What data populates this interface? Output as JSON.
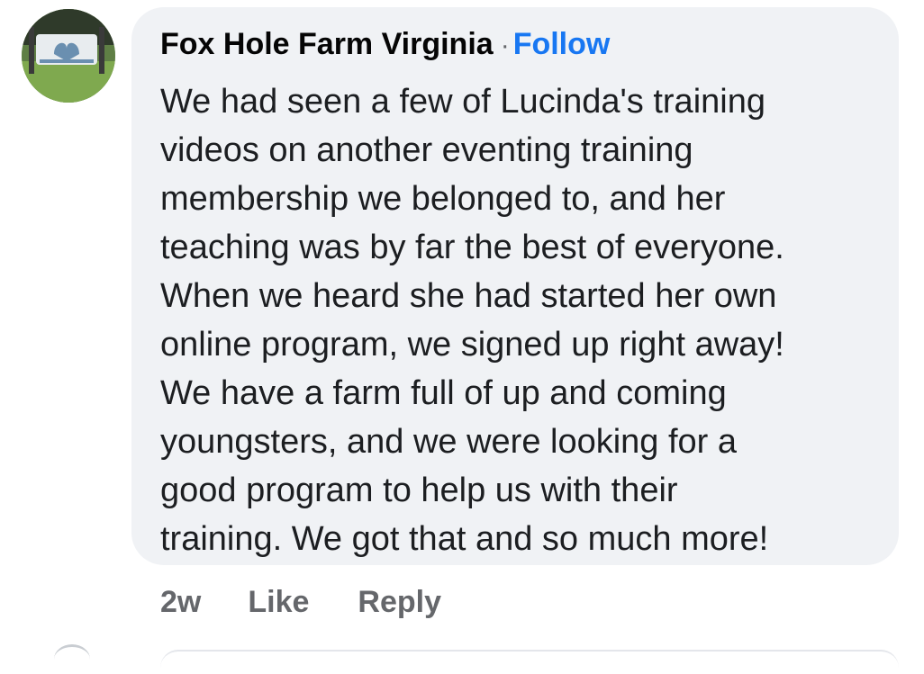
{
  "comment": {
    "author": "Fox Hole Farm Virginia",
    "separator": "·",
    "follow_label": "Follow",
    "avatar_icon": "farm-sign-avatar-icon",
    "body_lines": [
      "We had seen a few of Lucinda's training",
      "videos on another eventing training",
      "membership we belonged to, and her",
      "teaching was by far the best of everyone.",
      "When we heard she had started her own",
      "online program, we signed up right away!",
      "We have a farm full of up and coming",
      "youngsters, and we were looking for a",
      "good program to help us with their",
      "training.  We got that and so much more!"
    ],
    "timestamp": "2w",
    "like_label": "Like",
    "reply_label": "Reply"
  },
  "colors": {
    "bubble_background": "#f0f2f5",
    "link_blue": "#1877f2",
    "meta_gray": "#65676b",
    "text_dark": "#1c1e21"
  }
}
